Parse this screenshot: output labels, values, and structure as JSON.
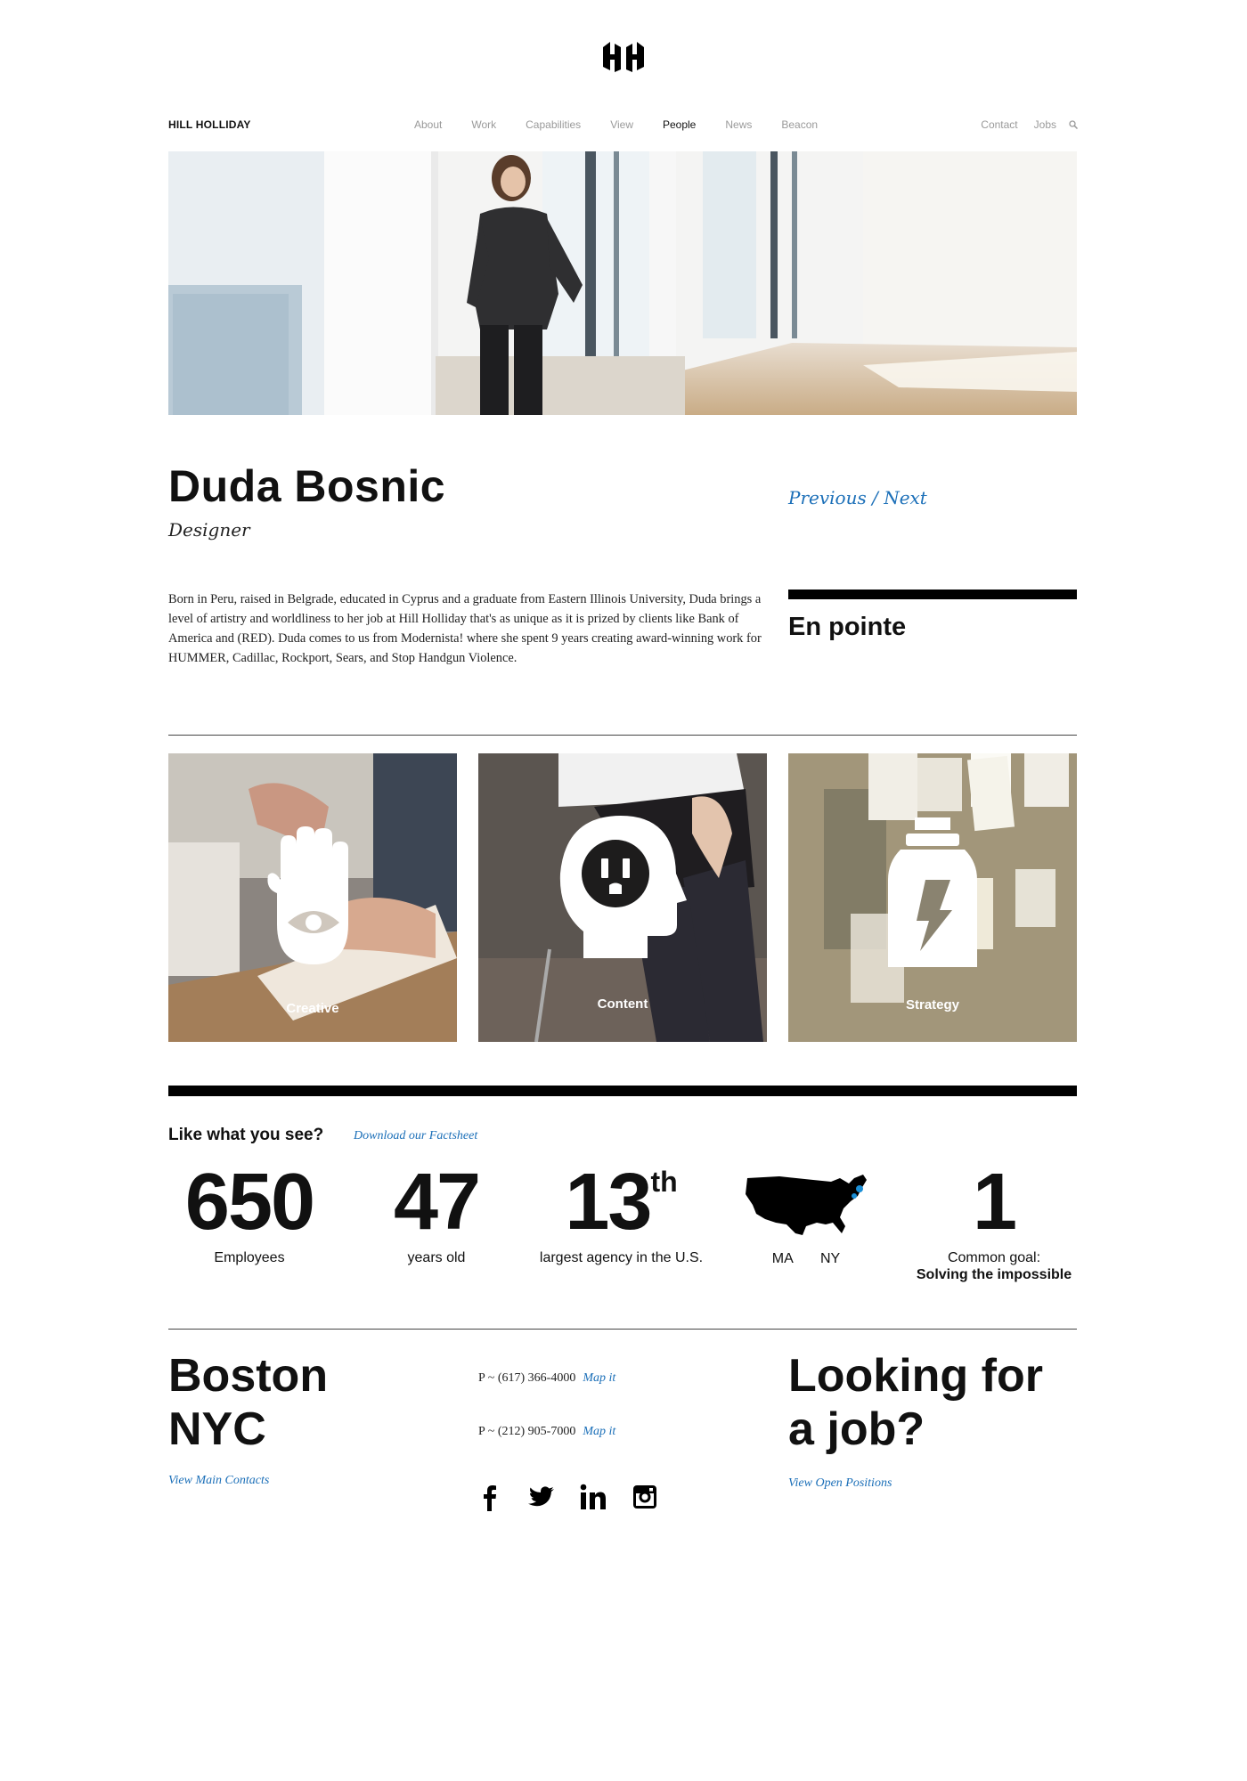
{
  "header": {
    "brand": "HILL HOLLIDAY",
    "nav": [
      "About",
      "Work",
      "Capabilities",
      "View",
      "People",
      "News",
      "Beacon"
    ],
    "active": "People",
    "nav_right": [
      "Contact",
      "Jobs"
    ]
  },
  "profile": {
    "name": "Duda Bosnic",
    "title": "Designer",
    "previous": "Previous",
    "separator": " / ",
    "next": "Next",
    "bio": "Born in Peru, raised in Belgrade, educated in Cyprus and a graduate from Eastern Illinois University, Duda brings a level of artistry and worldliness to her job at Hill Holliday that's as unique as it is prized by clients like Bank of America and (RED). Duda comes to us from Modernista! where she spent 9 years creating award-winning work for HUMMER, Cadillac, Rockport, Sears, and Stop Handgun Violence.",
    "side_heading": "En pointe"
  },
  "tiles": [
    {
      "label": "Creative",
      "icon": "hand-eye-icon"
    },
    {
      "label": "Content",
      "icon": "head-outlet-icon"
    },
    {
      "label": "Strategy",
      "icon": "lightning-bottle-icon"
    }
  ],
  "stats": {
    "heading": "Like what you see?",
    "factsheet": "Download our Factsheet",
    "employees": {
      "value": "650",
      "label": "Employees"
    },
    "age": {
      "value": "47",
      "label": "years old"
    },
    "rank": {
      "value": "13",
      "suffix": "th",
      "label": "largest agency in the U.S."
    },
    "locations": {
      "ma": "MA",
      "ny": "NY"
    },
    "goal": {
      "value": "1",
      "label": "Common goal:",
      "sub": "Solving the impossible"
    }
  },
  "footer": {
    "city1": "Boston",
    "city2": "NYC",
    "contacts_link": "View Main Contacts",
    "phone1": "P ~ (617) 366-4000",
    "phone2": "P ~ (212) 905-7000",
    "map_link": "Map it",
    "job_line1": "Looking for",
    "job_line2": "a job?",
    "positions_link": "View Open Positions"
  },
  "colors": {
    "accent": "#1b6fb8",
    "text": "#111111",
    "muted": "#9a9a9a"
  }
}
